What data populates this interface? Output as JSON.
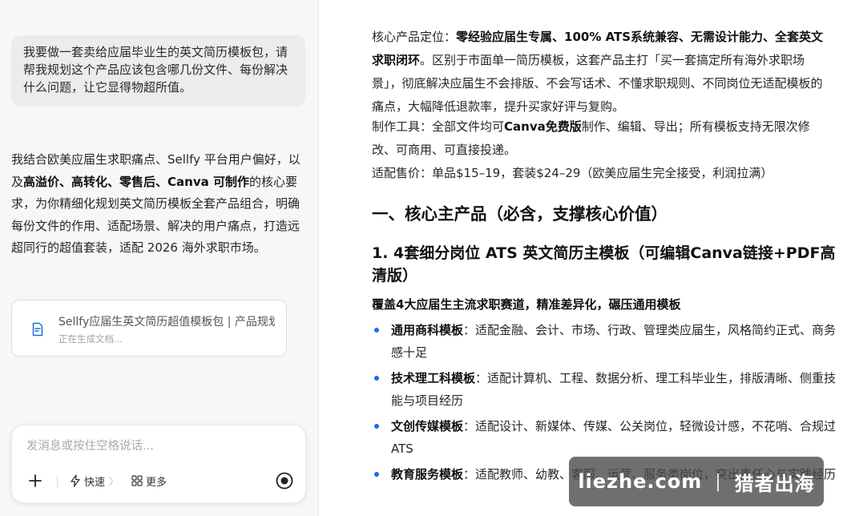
{
  "chat": {
    "user_message": "我要做一套卖给应届毕业生的英文简历模板包，请帮我规划这个产品应该包含哪几份文件、每份解决什么问题，让它显得物超所值。",
    "assistant_intro": {
      "t1": "我结合欧美应届生求职痛点、Sellfy 平台用户偏好，以及",
      "b1": "高溢价、高转化、零售后、Canva 可制作",
      "t2": "的核心要求，为你精细化规划英文简历模板全套产品组合，明确每份文件的作用、适配场景、解决的用户痛点，打造远超同行的超值套装，适配 2026 海外求职市场。"
    },
    "doc_card": {
      "title": "Sellfy应届生英文简历超值模板包 | 产品规划",
      "status": "正在生成文档...",
      "icon": "document-edit-icon"
    },
    "composer": {
      "placeholder": "发消息或按住空格说话...",
      "fast_label": "快速",
      "more_label": "更多"
    }
  },
  "document": {
    "p1": {
      "label": "核心产品定位：",
      "bold": "零经验应届生专属、100% ATS系统兼容、无需设计能力、全套英文求职闭环",
      "rest": "。区别于市面单一简历模板，这套产品主打「买一套搞定所有海外求职场景」，彻底解决应届生不会排版、不会写话术、不懂求职规则、不同岗位无适配模板的痛点，大幅降低退款率，提升买家好评与复购。"
    },
    "p2": {
      "label": "制作工具：全部文件均可",
      "bold": "Canva免费版",
      "rest": "制作、编辑、导出；所有模板支持无限次修改、可商用、可直接投递。"
    },
    "p3": "适配售价：单品$15–19，套装$24–29（欧美应届生完全接受，利润拉满）",
    "h1": "一、核心主产品（必含，支撑核心价值）",
    "h2": "1. 4套细分岗位 ATS 英文简历主模板（可编辑Canva链接+PDF高清版）",
    "h3": "覆盖4大应届生主流求职赛道，精准差异化，碾压通用模板",
    "bullets": [
      {
        "title": "通用商科模板",
        "desc": "：适配金融、会计、市场、行政、管理类应届生，风格简约正式、商务感十足"
      },
      {
        "title": "技术理工科模板",
        "desc": "：适配计算机、工程、数据分析、理工科毕业生，排版清晰、侧重技能与项目经历"
      },
      {
        "title": "文创传媒模板",
        "desc": "：适配设计、新媒体、传媒、公关岗位，轻微设计感，不花哨、合规过ATS"
      },
      {
        "title": "教育服务模板",
        "desc": "：适配教师、幼教、客服、运营、服务类岗位，突出责任心与实践经历"
      }
    ]
  },
  "watermark": {
    "left": "liezhe.com",
    "sep": "|",
    "right": "猎者出海"
  },
  "colors": {
    "bullet": "#1a6fe0",
    "left_bg": "#f7f7f8"
  }
}
